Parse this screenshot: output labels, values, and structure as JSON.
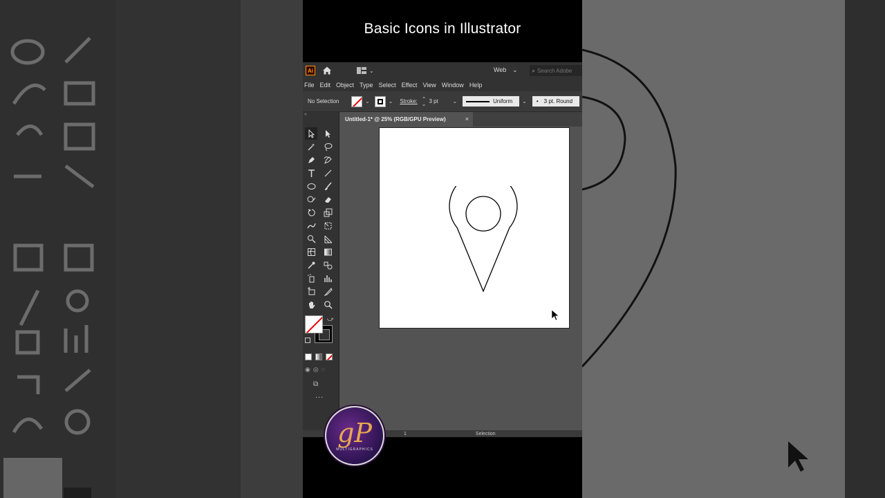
{
  "video": {
    "title": "Basic Icons in Illustrator"
  },
  "app": {
    "logo_text": "Ai",
    "workspace": "Web",
    "search_placeholder": "Search Adobe",
    "menu": [
      "File",
      "Edit",
      "Object",
      "Type",
      "Select",
      "Effect",
      "View",
      "Window",
      "Help"
    ],
    "control_bar": {
      "selection_state": "No Selection",
      "stroke_label": "Stroke:",
      "stroke_weight": "3 pt",
      "profile": "Uniform",
      "brush": "3 pt. Round"
    },
    "document_tab": {
      "title": "Untitled-1* @ 25% (RGB/GPU Preview)",
      "close": "×"
    },
    "status_bar": {
      "zoom": "1",
      "tool": "Selection"
    },
    "more_tools": "..."
  },
  "brand": {
    "logo_text": "gP",
    "logo_subtitle": "MULTIGRAPHICS"
  },
  "colors": {
    "accent": "#ff9a00",
    "app_bg": "#535353",
    "panel_bg": "#323232",
    "none_red": "#e00000"
  },
  "icons": {
    "home": "home-icon",
    "search": "search-icon",
    "selection": "selection-tool-icon",
    "direct_selection": "direct-selection-tool-icon",
    "pen": "pen-tool-icon",
    "type": "type-tool-icon",
    "line": "line-tool-icon",
    "ellipse": "ellipse-tool-icon",
    "brush": "paintbrush-tool-icon",
    "eraser": "eraser-tool-icon",
    "rotate": "rotate-tool-icon",
    "scale": "scale-tool-icon",
    "hand": "hand-tool-icon",
    "zoom": "zoom-tool-icon"
  }
}
